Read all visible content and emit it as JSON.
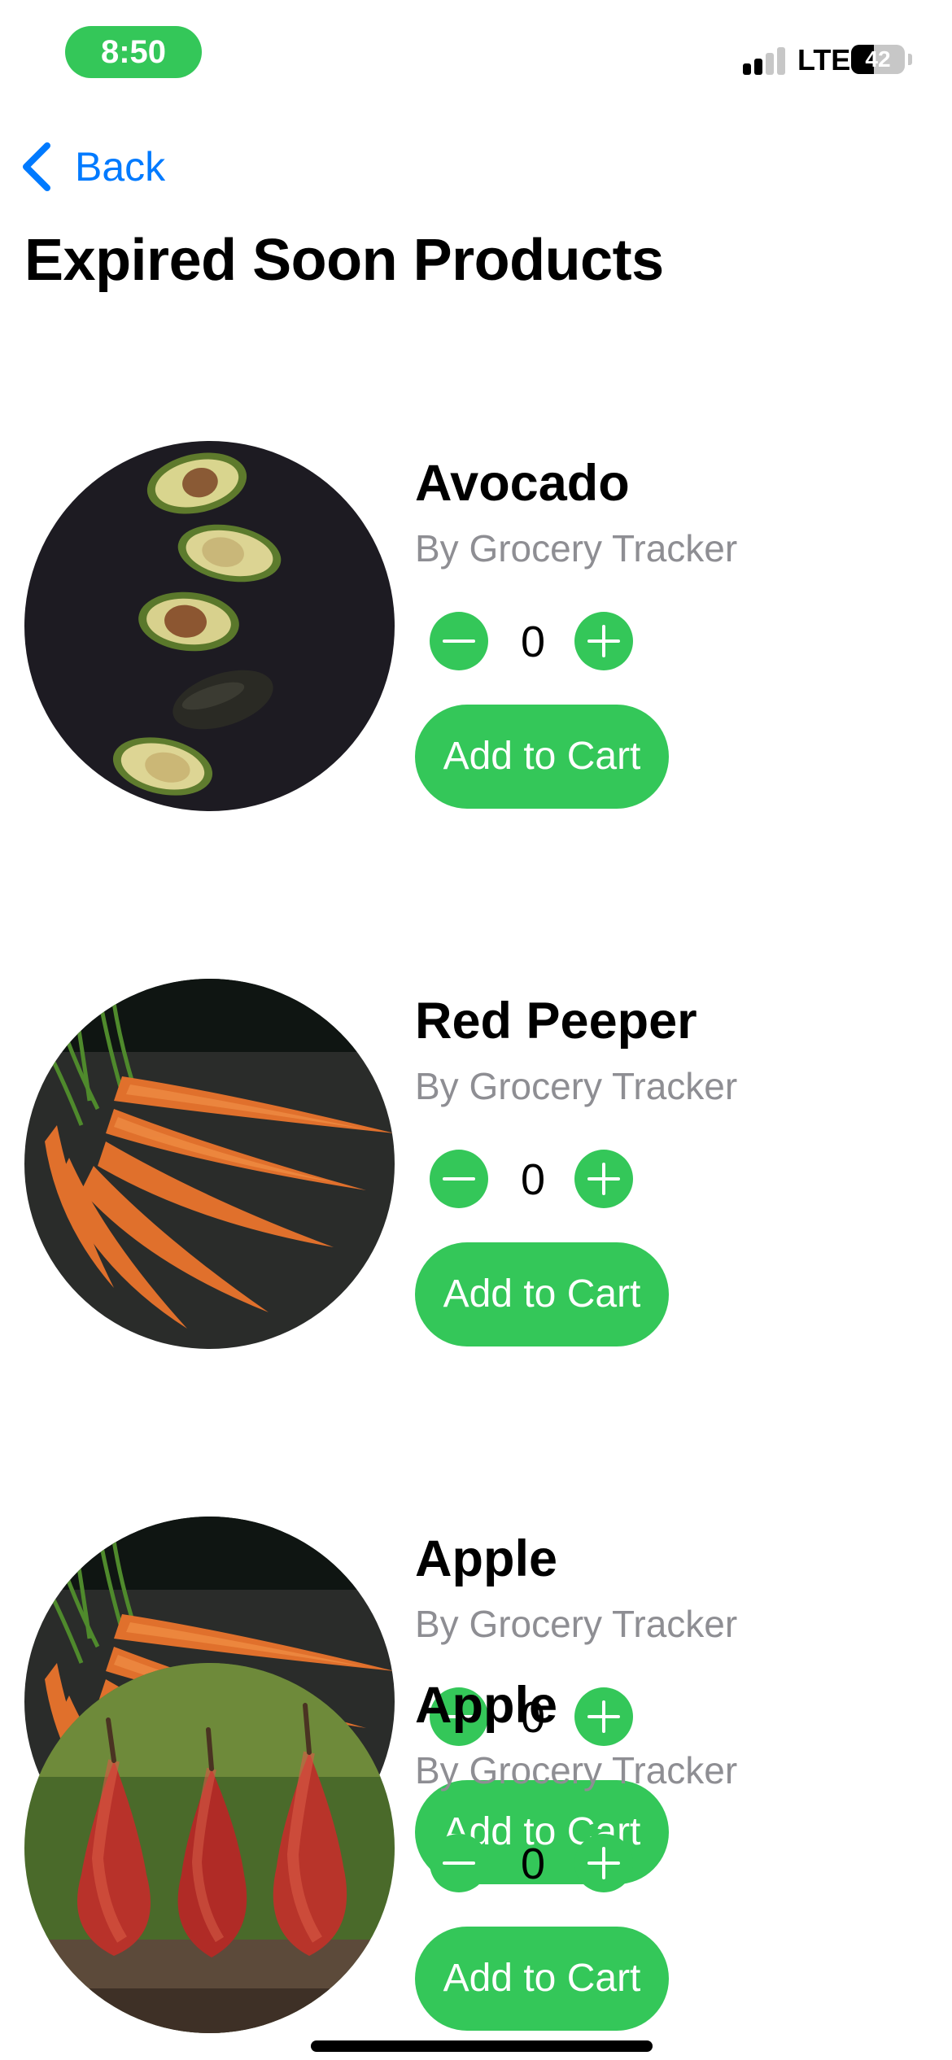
{
  "status_bar": {
    "time": "8:50",
    "network": "LTE",
    "battery": "42",
    "battery_level_percent": 42,
    "signal_bars_active": 2,
    "signal_bars_total": 4
  },
  "nav": {
    "back_label": "Back"
  },
  "page": {
    "title": "Expired Soon Products"
  },
  "products": [
    {
      "name": "Avocado",
      "subtitle": "By Grocery Tracker",
      "quantity": "0",
      "cart_label": "Add to Cart",
      "image": "avocado-photo"
    },
    {
      "name": "Red Peeper",
      "subtitle": "By Grocery Tracker",
      "quantity": "0",
      "cart_label": "Add to Cart",
      "image": "carrots-photo"
    },
    {
      "name": "Apple",
      "subtitle": "By Grocery Tracker",
      "quantity": "0",
      "cart_label": "Add to Cart",
      "image": "carrots-photo"
    },
    {
      "name": "Apple",
      "subtitle": "By Grocery Tracker",
      "quantity": "0",
      "cart_label": "Add to Cart",
      "image": "pears-photo"
    }
  ],
  "icons": {
    "back": "chevron-left-icon",
    "minus": "minus-circle-icon",
    "plus": "plus-circle-icon"
  },
  "colors": {
    "accent_green": "#34c759",
    "link_blue": "#007aff",
    "secondary_text": "#8e8e93"
  }
}
